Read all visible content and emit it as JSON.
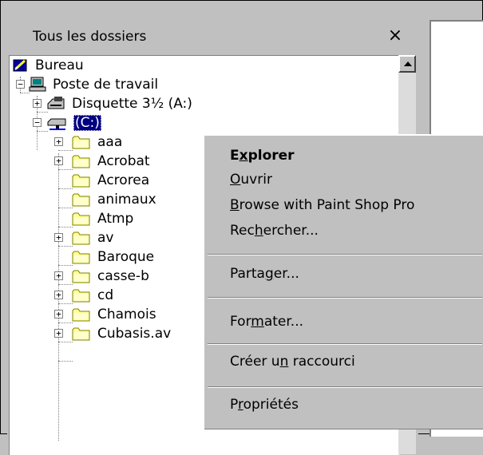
{
  "panel": {
    "title": "Tous les dossiers",
    "close_glyph": "×"
  },
  "tree": {
    "desktop": "Bureau",
    "computer": "Poste de travail",
    "floppy": "Disquette 3½ (A:)",
    "drive_c": "(C:)",
    "folders": [
      "aaa",
      "Acrobat",
      "Acrorea",
      "animaux",
      "Atmp",
      "av",
      "Baroque",
      "casse-b",
      "cd",
      "Chamois",
      "Cubasis.av"
    ]
  },
  "context_menu": {
    "items": [
      {
        "pre": "E",
        "u": "x",
        "post": "plorer",
        "bold": true
      },
      {
        "pre": "",
        "u": "O",
        "post": "uvrir"
      },
      {
        "pre": "",
        "u": "B",
        "post": "rowse with Paint Shop Pro"
      },
      {
        "pre": "Rec",
        "u": "h",
        "post": "ercher..."
      },
      {
        "pre": "Parta",
        "u": "g",
        "post": "er..."
      },
      {
        "pre": "For",
        "u": "m",
        "post": "ater..."
      },
      {
        "pre": "Créer u",
        "u": "n",
        "post": " raccourci"
      },
      {
        "pre": "P",
        "u": "r",
        "post": "opriétés"
      }
    ]
  },
  "colors": {
    "selection": "#000080",
    "face": "#c0c0c0",
    "folder": "#ffff99"
  }
}
